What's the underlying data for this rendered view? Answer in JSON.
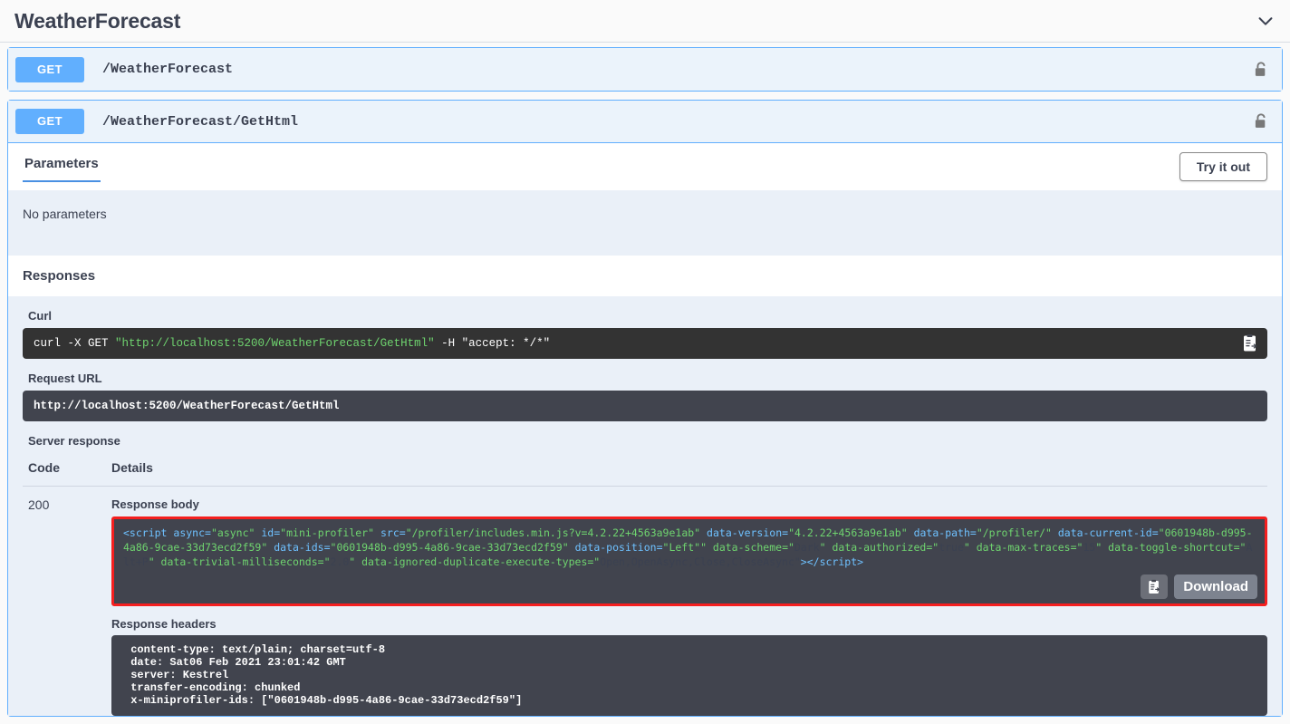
{
  "tag": {
    "title": "WeatherForecast",
    "collapse_icon": "chevron-down-icon"
  },
  "operations": [
    {
      "method": "GET",
      "path": "/WeatherForecast",
      "auth_icon": "unlocked-padlock-icon",
      "expanded": false
    },
    {
      "method": "GET",
      "path": "/WeatherForecast/GetHtml",
      "auth_icon": "unlocked-padlock-icon",
      "expanded": true
    }
  ],
  "detail": {
    "parameters_tab": "Parameters",
    "try_it_out_label": "Try it out",
    "no_parameters": "No parameters",
    "responses_title": "Responses",
    "curl_label": "Curl",
    "curl_prefix": "curl -X GET ",
    "curl_url": "\"http://localhost:5200/WeatherForecast/GetHtml\"",
    "curl_suffix": " -H  \"accept: */*\"",
    "request_url_label": "Request URL",
    "request_url": "http://localhost:5200/WeatherForecast/GetHtml",
    "server_response_label": "Server response",
    "table_headers": {
      "code": "Code",
      "details": "Details"
    },
    "response_code": "200",
    "response_body_label": "Response body",
    "response_body_text": "<script async=\"async\" id=\"mini-profiler\" src=\"/profiler/includes.min.js?v=4.2.22+4563a9e1ab\" data-version=\"4.2.22+4563a9e1ab\" data-path=\"/profiler/\" data-current-id=\"0601948b-d995-4a86-9cae-33d73ecd2f59\" data-ids=\"0601948b-d995-4a86-9cae-33d73ecd2f59\" data-position=\"Left\"\" data-scheme=\"Dark\" data-authorized=\"true\" data-max-traces=\"15\" data-toggle-shortcut=\"Alt+P\" data-trivial-milliseconds=\"2.0\" data-ignored-duplicate-execute-types=\"Open,OpenAsync,Close,CloseAsync\"></script>",
    "download_label": "Download",
    "copy_icon": "clipboard-copy-icon",
    "response_headers_label": "Response headers",
    "response_headers_text": " content-type: text/plain; charset=utf-8 \n date: Sat06 Feb 2021 23:01:42 GMT \n server: Kestrel \n transfer-encoding: chunked \n x-miniprofiler-ids: [\"0601948b-d995-4a86-9cae-33d73ecd2f59\"] "
  },
  "colors": {
    "get_method": "#61affe",
    "opblock_border": "#61affe",
    "opblock_bg": "#ebf3fb",
    "tab_underline": "#4990e2",
    "highlight_border": "#f41f1f",
    "code_bg": "#41444e",
    "page_bg": "#fafafa"
  }
}
